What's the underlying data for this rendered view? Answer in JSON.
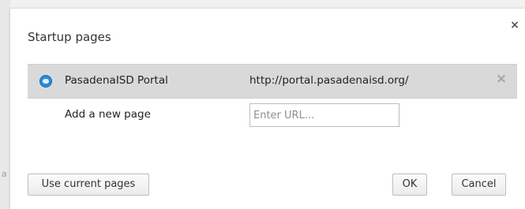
{
  "dialog": {
    "title": "Startup pages",
    "close_glyph": "×"
  },
  "startup_pages": [
    {
      "name": "PasadenaISD Portal",
      "url": "http://portal.pasadenaisd.org/",
      "favicon": "pasadenaisd-favicon",
      "remove_glyph": "×"
    }
  ],
  "add_page": {
    "label": "Add a new page",
    "url_placeholder": "Enter URL...",
    "url_value": ""
  },
  "buttons": {
    "use_current": "Use current pages",
    "ok": "OK",
    "cancel": "Cancel"
  },
  "background": {
    "edge_char": "a"
  },
  "colors": {
    "selected_row_bg": "#d9d9d9",
    "favicon_blue": "#2a8ad8",
    "dialog_bg": "#ffffff"
  }
}
